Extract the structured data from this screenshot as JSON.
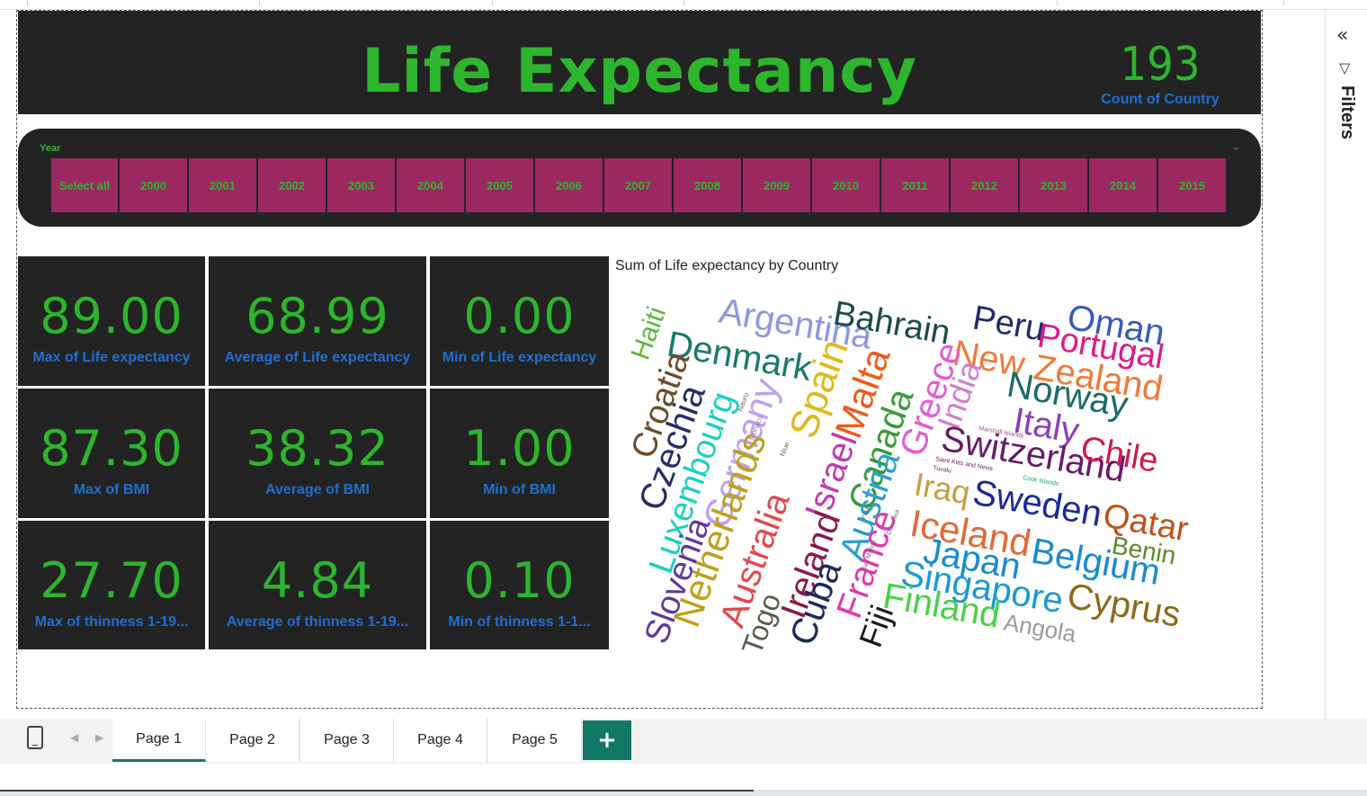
{
  "report": {
    "title": "Life Expectancy",
    "count_value": "193",
    "count_label": "Count of Country"
  },
  "slicer": {
    "title": "Year",
    "items": [
      "Select all",
      "2000",
      "2001",
      "2002",
      "2003",
      "2004",
      "2005",
      "2006",
      "2007",
      "2008",
      "2009",
      "2010",
      "2011",
      "2012",
      "2013",
      "2014",
      "2015"
    ]
  },
  "cards": [
    {
      "value": "89.00",
      "label": "Max of Life expectancy"
    },
    {
      "value": "68.99",
      "label": "Average of Life expectancy"
    },
    {
      "value": "0.00",
      "label": "Min of Life expectancy"
    },
    {
      "value": "87.30",
      "label": "Max of BMI"
    },
    {
      "value": "38.32",
      "label": "Average of BMI"
    },
    {
      "value": "1.00",
      "label": "Min of BMI"
    },
    {
      "value": "27.70",
      "label": "Max of  thinness  1-19..."
    },
    {
      "value": "4.84",
      "label": "Average of  thinness  1-19..."
    },
    {
      "value": "0.10",
      "label": "Min of  thinness  1-1..."
    }
  ],
  "wordcloud": {
    "title": "Sum of Life expectancy by Country",
    "words": [
      "Argentina",
      "Bahrain",
      "Peru",
      "Oman",
      "Portugal",
      "New Zealand",
      "Haiti",
      "Denmark",
      "Malta",
      "India",
      "Norway",
      "Croatia",
      "Spain",
      "Greece",
      "Italy",
      "Czechia",
      "Germany",
      "Switzerland",
      "Chile",
      "Luxembourg",
      "Canada",
      "Israel",
      "Iraq",
      "Sweden",
      "Qatar",
      "Netherlands",
      "Austria",
      "Iceland",
      "Benin",
      "Slovenia",
      "Australia",
      "Ireland",
      "Japan",
      "Belgium",
      "Togo",
      "Cuba",
      "France",
      "Singapore",
      "Cyprus",
      "Fiji",
      "Finland",
      "Angola",
      "Nauru",
      "Monaco",
      "Niue",
      "Marshall Islands",
      "Saint Kitts and Nevis",
      "Tuvalu",
      "Cook Islands",
      "Palau",
      "Dominica",
      "San Marino"
    ]
  },
  "filters": {
    "label": "Filters"
  },
  "tabs": [
    "Page 1",
    "Page 2",
    "Page 3",
    "Page 4",
    "Page 5"
  ],
  "colors": {
    "accent_green": "#2db52d",
    "label_blue": "#1f6fd1",
    "card_bg": "#232323",
    "slicer_btn": "#9b2860",
    "tab_accent": "#117865"
  }
}
